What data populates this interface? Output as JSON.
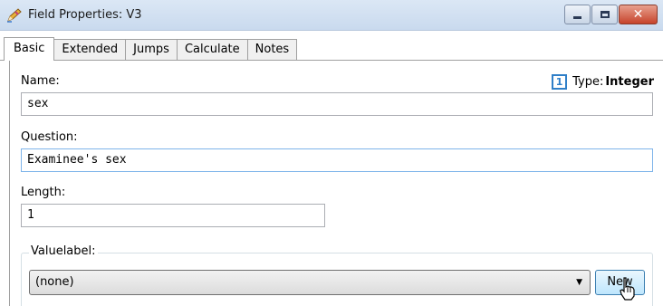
{
  "window": {
    "title": "Field Properties: V3",
    "icon": "pencil-icon",
    "buttons": {
      "minimize": "minimize-icon",
      "maximize": "maximize-icon",
      "close": "close-icon"
    }
  },
  "tabs": [
    {
      "label": "Basic",
      "active": true
    },
    {
      "label": "Extended",
      "active": false
    },
    {
      "label": "Jumps",
      "active": false
    },
    {
      "label": "Calculate",
      "active": false
    },
    {
      "label": "Notes",
      "active": false
    }
  ],
  "form": {
    "name_label": "Name:",
    "name_value": "sex",
    "type_icon_text": "1",
    "type_label": "Type:",
    "type_value": "Integer",
    "question_label": "Question:",
    "question_value": "Examinee's sex",
    "length_label": "Length:",
    "length_value": "1",
    "valuelabel_legend": "Valuelabel:",
    "valuelabel_selected": "(none)",
    "new_button_label": "New"
  },
  "colors": {
    "accent": "#2f7fc8",
    "focus_border": "#7eb4ea",
    "close_red": "#c6442c"
  }
}
